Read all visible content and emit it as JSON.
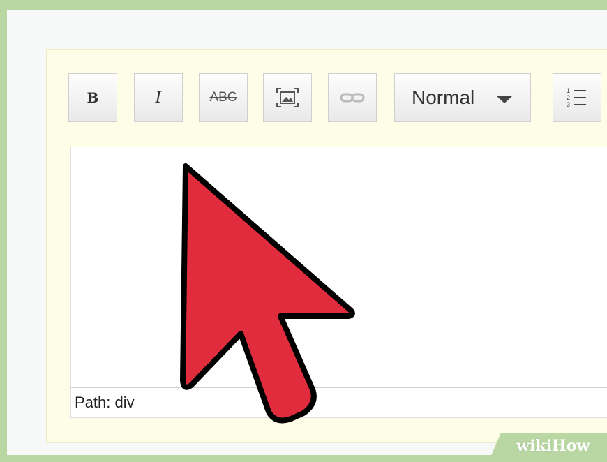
{
  "toolbar": {
    "bold_label": "B",
    "italic_label": "I",
    "strike_label": "ABC",
    "format_select": {
      "selected": "Normal"
    }
  },
  "path_bar": {
    "text": "Path: div"
  },
  "cursor": {
    "color": "#e02c3c",
    "outline": "#000000",
    "icon": "arrow-cursor-icon"
  },
  "watermark": {
    "wiki": "wiki",
    "how": "How"
  },
  "colors": {
    "frame": "#b9d7a3",
    "panel": "#fdfde8"
  }
}
